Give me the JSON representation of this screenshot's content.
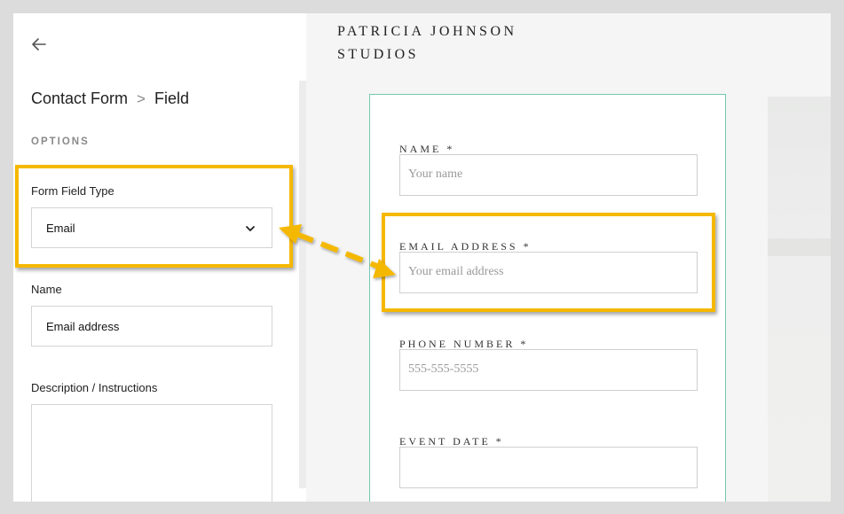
{
  "sidebar": {
    "breadcrumb": {
      "parent": "Contact Form",
      "separator": ">",
      "current": "Field"
    },
    "options_label": "OPTIONS",
    "field_type": {
      "label": "Form Field Type",
      "value": "Email"
    },
    "name": {
      "label": "Name",
      "value": "Email address"
    },
    "description": {
      "label": "Description / Instructions",
      "value": ""
    }
  },
  "preview": {
    "brand_line1": "PATRICIA JOHNSON",
    "brand_line2": "STUDIOS",
    "fields": {
      "name": {
        "label": "NAME *",
        "placeholder": "Your name"
      },
      "email": {
        "label": "EMAIL ADDRESS *",
        "placeholder": "Your email address"
      },
      "phone": {
        "label": "PHONE NUMBER *",
        "placeholder": "555-555-5555"
      },
      "event_date": {
        "label": "EVENT DATE *",
        "placeholder": ""
      }
    }
  },
  "colors": {
    "highlight": "#f5b800",
    "form_border": "#72c9ad"
  },
  "icons": {
    "back": "arrow-left-icon",
    "dropdown": "chevron-down-icon"
  }
}
